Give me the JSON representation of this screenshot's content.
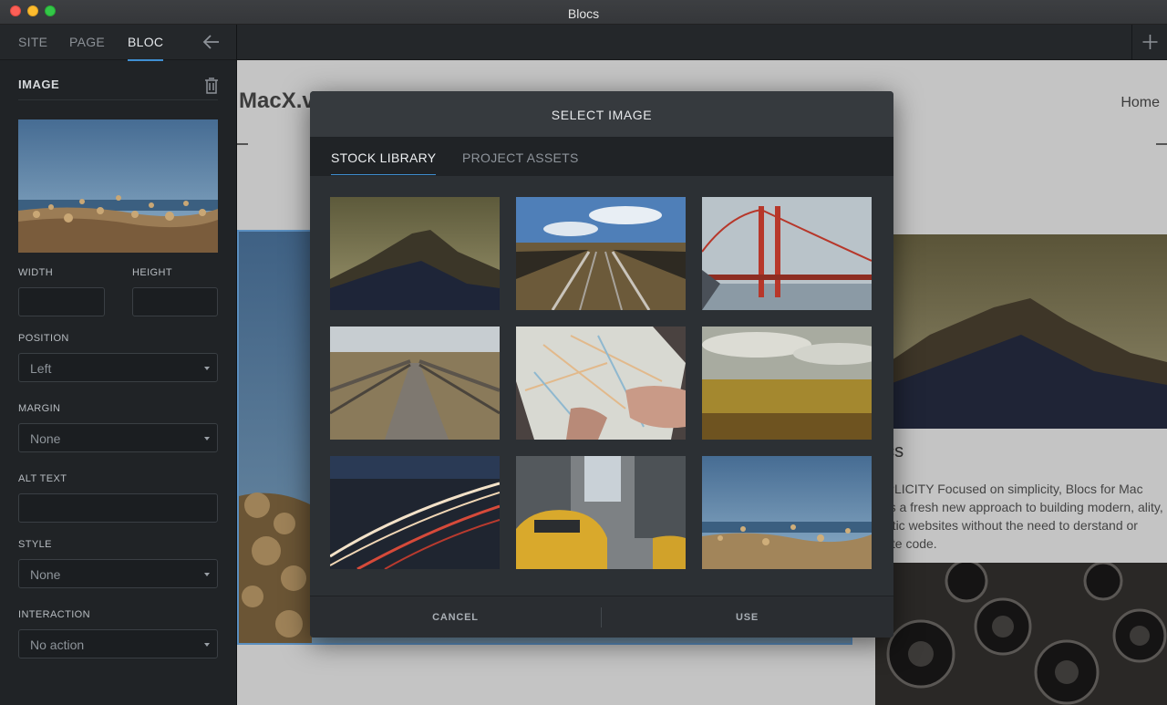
{
  "window": {
    "title": "Blocs"
  },
  "sidebar": {
    "tabs": [
      "SITE",
      "PAGE",
      "BLOC"
    ],
    "section_title": "IMAGE",
    "width_label": "WIDTH",
    "height_label": "HEIGHT",
    "width_value": "",
    "height_value": "",
    "position_label": "POSITION",
    "position_value": "Left",
    "margin_label": "MARGIN",
    "margin_value": "None",
    "alt_label": "ALT TEXT",
    "alt_value": "",
    "style_label": "STYLE",
    "style_value": "None",
    "interaction_label": "INTERACTION",
    "interaction_value": "No action"
  },
  "page": {
    "brand": "MacX.v",
    "nav_home": "Home",
    "heading": "ocs",
    "body": "MPLICITY Focused on simplicity, Blocs for Mac ngs a fresh new approach to building modern, ality, static websites without the need to derstand or write code."
  },
  "modal": {
    "title": "SELECT IMAGE",
    "tabs": [
      "STOCK LIBRARY",
      "PROJECT ASSETS"
    ],
    "active_tab": "STOCK LIBRARY",
    "images": [
      "mountain",
      "railway",
      "golden-gate-bridge",
      "boardwalk",
      "map",
      "wheat-field",
      "light-trails",
      "taxi-street",
      "coastal-flowers"
    ],
    "cancel_label": "CANCEL",
    "use_label": "USE"
  },
  "colors": {
    "accent": "#3f8fd2",
    "sidebar_bg": "#202326",
    "modal_bg": "#2c3034"
  }
}
